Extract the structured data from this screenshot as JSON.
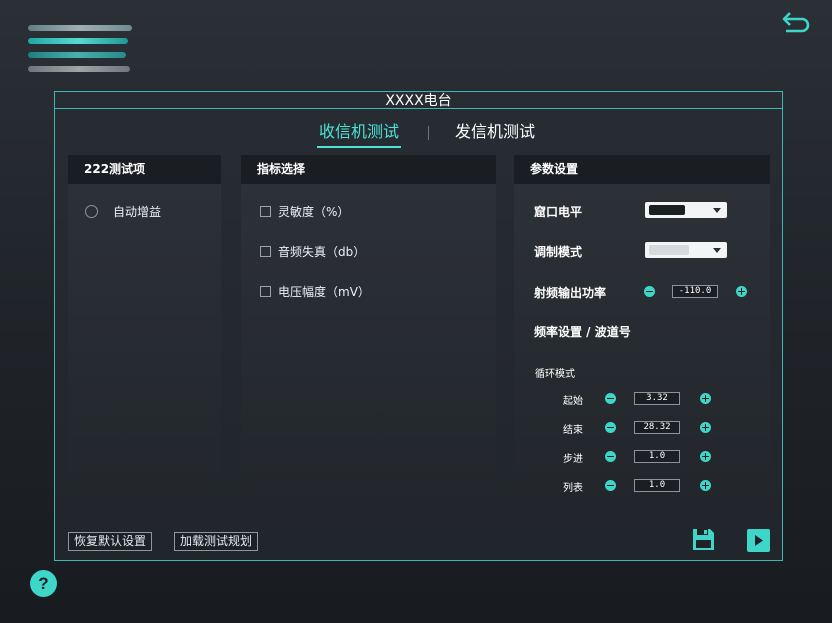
{
  "colors": {
    "accent": "#3ed6c9",
    "frame": "#3fb8b4",
    "panel_head": "#1a1d21"
  },
  "window": {
    "title": "XXXX电台"
  },
  "tabs": [
    {
      "label": "收信机测试",
      "active": true
    },
    {
      "label": "发信机测试",
      "active": false
    }
  ],
  "left_panel": {
    "title": "222测试项",
    "items": [
      {
        "label": "自动增益",
        "selected": false
      }
    ]
  },
  "middle_panel": {
    "title": "指标选择",
    "items": [
      {
        "label": "灵敏度（%）",
        "checked": false
      },
      {
        "label": "音频失真（db）",
        "checked": false
      },
      {
        "label": "电压幅度（mV）",
        "checked": false
      }
    ]
  },
  "right_panel": {
    "title": "参数设置",
    "port_level_label": "窟口电平",
    "modulation_label": "调制模式",
    "rf_power_label": "射频输出功率",
    "rf_power_value": "-110.0",
    "freq_label": "频率设置 / 波道号",
    "cycle_mode_label": "循环模式",
    "cycle_rows": [
      {
        "label": "起始",
        "value": "3.32"
      },
      {
        "label": "结束",
        "value": "28.32"
      },
      {
        "label": "步进",
        "value": "1.0"
      },
      {
        "label": "列表",
        "value": "1.0"
      }
    ]
  },
  "footer": {
    "restore_default": "恢复默认设置",
    "load_plan": "加载测试规划"
  },
  "icons": {
    "back": "back-arrow-icon",
    "help_glyph": "?",
    "save": "save-icon",
    "play": "play-icon",
    "help": "help-icon"
  }
}
